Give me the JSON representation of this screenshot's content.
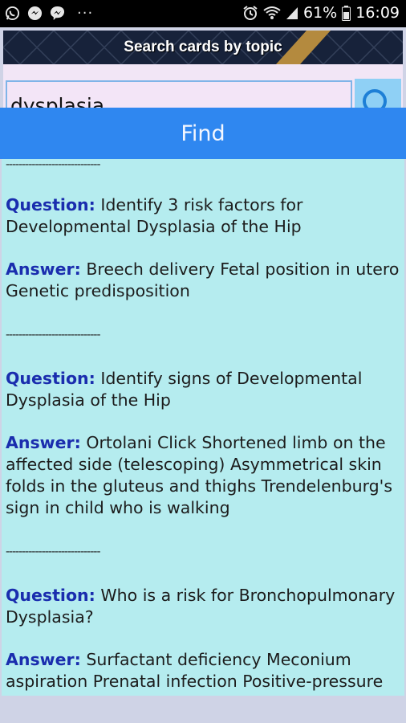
{
  "status_bar": {
    "left_icons": [
      "whatsapp-icon",
      "messenger-style-icon",
      "messenger-icon"
    ],
    "overflow": "···",
    "battery_percent": "61%",
    "time": "16:09"
  },
  "header": {
    "title": "Search cards by topic"
  },
  "search": {
    "value": "dysplasia",
    "placeholder": ""
  },
  "find_button": {
    "label": "Find"
  },
  "separator": "-----------------------------",
  "labels": {
    "question": "Question:",
    "answer": "Answer:"
  },
  "results": [
    {
      "question": "Identify 3 risk factors for Developmental Dysplasia of the Hip",
      "answer": "Breech delivery Fetal position in utero Genetic predisposition"
    },
    {
      "question": "Identify signs of Developmental Dysplasia of the Hip",
      "answer": "Ortolani Click Shortened limb on the affected side (telescoping) Asymmetrical skin folds in the gluteus and thighs Trendelenburg's sign in child who is walking"
    },
    {
      "question": "Who is a risk for Bronchopulmonary Dysplasia?",
      "answer": "Surfactant deficiency Meconium aspiration Prenatal infection Positive-pressure"
    }
  ]
}
